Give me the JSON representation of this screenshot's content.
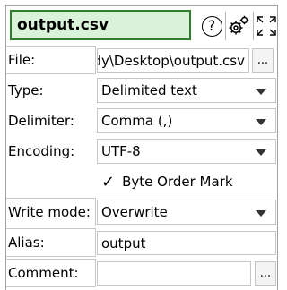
{
  "header": {
    "title": "output.csv",
    "help_icon_glyph": "?",
    "help_icon": "question-circle-icon",
    "settings_icon": "gear-icon",
    "expand_icon": "expand-icon"
  },
  "fields": {
    "file": {
      "label": "File:",
      "value": "dy\\Desktop\\output.csv",
      "browse_label": "..."
    },
    "type": {
      "label": "Type:",
      "value": "Delimited text"
    },
    "delimiter": {
      "label": "Delimiter:",
      "value": "Comma (,)"
    },
    "encoding": {
      "label": "Encoding:",
      "value": "UTF-8"
    },
    "bom": {
      "check_glyph": "✓",
      "label": "Byte Order Mark",
      "checked": true
    },
    "write_mode": {
      "label": "Write mode:",
      "value": "Overwrite"
    },
    "alias": {
      "label": "Alias:",
      "value": "output"
    },
    "comment": {
      "label": "Comment:",
      "value": "",
      "browse_label": "..."
    }
  },
  "colors": {
    "title_bg": "#d9f2d9",
    "title_border": "#2e7d2e"
  }
}
